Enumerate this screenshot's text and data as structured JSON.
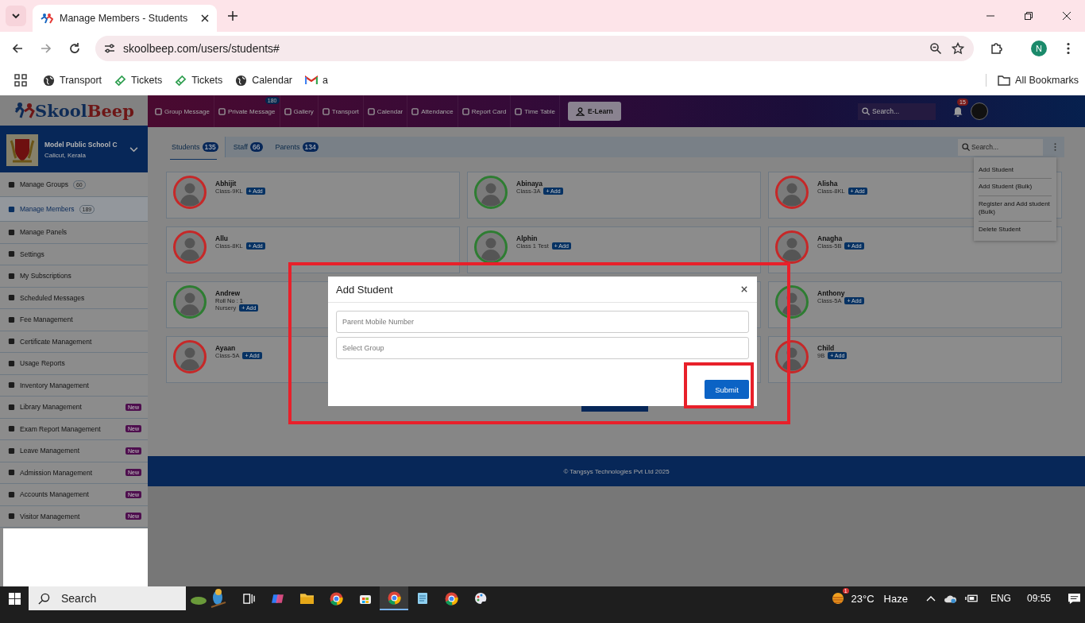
{
  "browser": {
    "tab": {
      "title": "Manage Members - Students"
    },
    "address": {
      "url": "skoolbeep.com/users/students#"
    },
    "profile": {
      "initial": "N"
    },
    "bookmarks": [
      {
        "label": "Transport",
        "kind": "globe"
      },
      {
        "label": "Tickets",
        "kind": "ticket"
      },
      {
        "label": "Tickets",
        "kind": "ticket"
      },
      {
        "label": "Calendar",
        "kind": "globe"
      },
      {
        "label": "a",
        "kind": "mail"
      }
    ],
    "all_bookmarks": "All Bookmarks"
  },
  "header": {
    "logo": [
      "Skool",
      "Beep"
    ],
    "nav": [
      {
        "label": "Group Message"
      },
      {
        "label": "Private Message",
        "badge": "180"
      },
      {
        "label": "Gallery"
      },
      {
        "label": "Transport"
      },
      {
        "label": "Calendar"
      },
      {
        "label": "Attendance"
      },
      {
        "label": "Report Card"
      },
      {
        "label": "Time Table"
      }
    ],
    "elearn": "E-Learn",
    "search": {
      "placeholder": "Search..."
    },
    "notifications": "15"
  },
  "school": {
    "name": "Model Public School C",
    "location": "Calicut, Kerala"
  },
  "sidebar": [
    {
      "label": "Manage Groups",
      "count": "60",
      "selected": false
    },
    {
      "label": "Manage Members",
      "count": "189",
      "selected": true
    },
    {
      "label": "Manage Panels",
      "selected": false
    },
    {
      "label": "Settings",
      "selected": false
    },
    {
      "label": "My Subscriptions",
      "selected": false
    },
    {
      "label": "Scheduled Messages",
      "selected": false
    },
    {
      "label": "Fee Management",
      "selected": false
    },
    {
      "label": "Certificate Management",
      "selected": false
    },
    {
      "label": "Usage Reports",
      "selected": false
    },
    {
      "label": "Inventory Management",
      "selected": false
    },
    {
      "label": "Library Management",
      "badge": "New",
      "selected": false
    },
    {
      "label": "Exam Report Management",
      "badge": "New",
      "selected": false
    },
    {
      "label": "Leave Management",
      "badge": "New",
      "selected": false
    },
    {
      "label": "Admission Management",
      "badge": "New",
      "selected": false
    },
    {
      "label": "Accounts Management",
      "badge": "New",
      "selected": false
    },
    {
      "label": "Visitor Management",
      "badge": "New",
      "selected": false
    }
  ],
  "tabs": [
    {
      "label": "Students",
      "count": "135",
      "selected": true
    },
    {
      "label": "Staff",
      "count": "66",
      "selected": false
    },
    {
      "label": "Parents",
      "count": "134",
      "selected": false
    }
  ],
  "member_search": {
    "placeholder": "Search..."
  },
  "menu": [
    "Add Student",
    "Add Student (Bulk)",
    "Register and Add student (Bulk)",
    "Delete Student"
  ],
  "card_rows": [
    [
      {
        "name": "Abhijit",
        "class": "Class-9KL",
        "button": "+ Add",
        "color": "#c62828"
      },
      {
        "name": "Abinaya",
        "class": "Class-3A",
        "button": "+ Add",
        "color": "#2e7d32"
      },
      {
        "name": "Alisha",
        "class": "Class-8KL",
        "button": "+ Add",
        "color": "#c62828"
      }
    ],
    [
      {
        "name": "Allu",
        "class": "Class-8KL",
        "button": "+ Add",
        "color": "#c62828"
      },
      {
        "name": "Alphin",
        "class": "Class 1 Test",
        "button": "+ Add",
        "color": "#2e7d32"
      },
      {
        "name": "Anagha",
        "class": "Class-5B",
        "button": "+ Add",
        "color": "#c62828"
      }
    ],
    [
      {
        "name": "Andrew",
        "roll": "Roll No : 1",
        "class": "Nursery",
        "button": "+ Add",
        "color": "#2e7d32"
      },
      null,
      {
        "name": "Anthony",
        "class": "Class-5A",
        "button": "+ Add",
        "color": "#2e7d32"
      }
    ],
    [
      {
        "name": "Ayaan",
        "class": "Class-5A",
        "button": "+ Add",
        "color": "#c62828"
      },
      null,
      {
        "name": "Child",
        "class": "9B",
        "button": "+ Add",
        "color": "#c62828"
      }
    ]
  ],
  "footer": "© Tangsys Technologies Pvt Ltd 2025",
  "modal": {
    "title": "Add Student",
    "fields": [
      {
        "placeholder": "Parent Mobile Number"
      },
      {
        "placeholder": "Select Group"
      }
    ],
    "submit": "Submit"
  },
  "taskbar": {
    "search": "Search",
    "weather": {
      "badge": "1",
      "temp": "23°C",
      "condition": "Haze"
    },
    "language": "ENG",
    "time": "09:55"
  }
}
